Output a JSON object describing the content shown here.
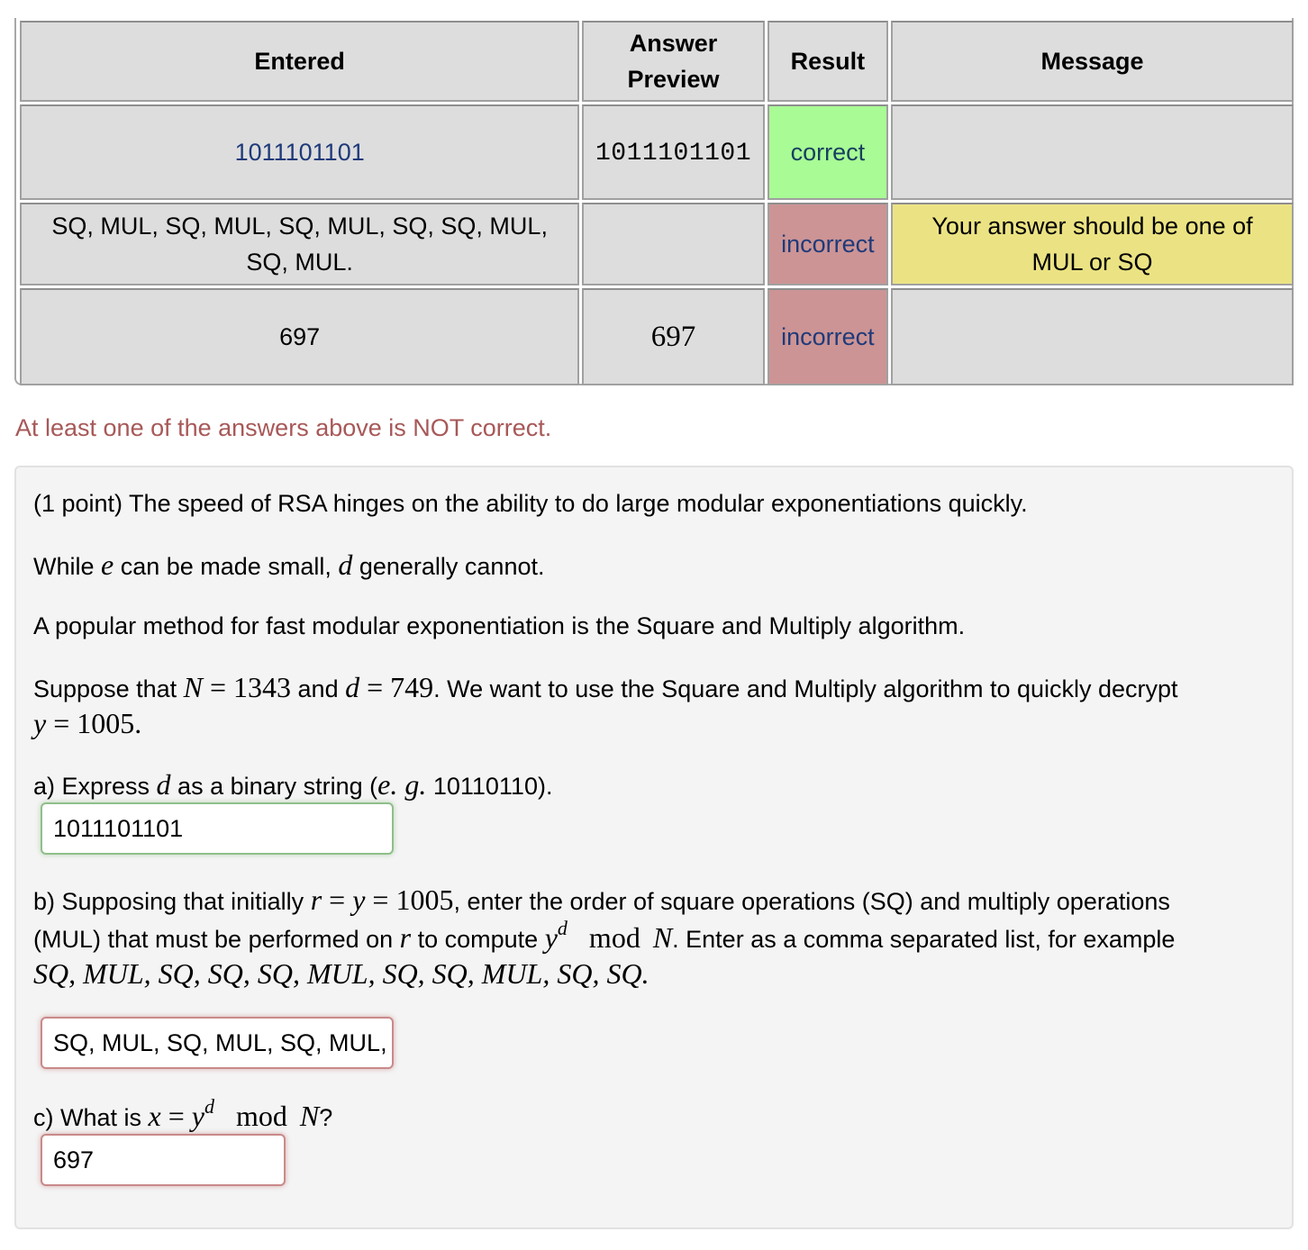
{
  "results_table": {
    "headers": {
      "entered": "Entered",
      "answer_preview_line1": "Answer",
      "answer_preview_line2": "Preview",
      "result": "Result",
      "message": "Message"
    },
    "rows": [
      {
        "entered": "1011101101",
        "preview": "1011101101",
        "result": "correct",
        "message": ""
      },
      {
        "entered_line1": "SQ, MUL, SQ, MUL, SQ, MUL, SQ, SQ, MUL,",
        "entered_line2": "SQ, MUL.",
        "preview": "",
        "result": "incorrect",
        "message_line1": "Your answer should be one of",
        "message_line2": "MUL or SQ"
      },
      {
        "entered": "697",
        "preview": "697",
        "result": "incorrect",
        "message": ""
      }
    ]
  },
  "status_message": "At least one of the answers above is NOT correct.",
  "problem": {
    "intro": "(1 point) The speed of RSA hinges on the ability to do large modular exponentiations quickly.",
    "line2": {
      "a": "While ",
      "e": "e",
      "b": " can be made small, ",
      "d": "d",
      "c": " generally cannot."
    },
    "line3": "A popular method for fast modular exponentiation is the Square and Multiply algorithm.",
    "line4": {
      "a": "Suppose that ",
      "N": "N",
      "eq1": " = ",
      "Nval": "1343",
      "and": " and ",
      "d": "d",
      "eq2": " = ",
      "dval": "749",
      "b": ". We want to use the Square and Multiply algorithm to quickly decrypt",
      "y": "y",
      "eq3": " = ",
      "yval": "1005",
      "end": "."
    },
    "part_a": {
      "a": "a) Express ",
      "d": "d",
      "b": " as a binary string (",
      "eg": "e. g.",
      "c": " 10110110).",
      "answer": "1011101101",
      "status": "correct"
    },
    "part_b": {
      "a": "b) Supposing that initially ",
      "r": "r",
      "eq": " = ",
      "y": "y",
      "eq2": " = ",
      "yval": "1005",
      "b": ", enter the order of square operations (SQ) and multiply operations",
      "c": "(MUL) that must be performed on ",
      "r2": "r",
      "d": " to compute ",
      "y2": "y",
      "sup": "d",
      "mod": "mod",
      "N": "N",
      "e": ". Enter as a comma separated list, for example",
      "example": "SQ, MUL, SQ, SQ, SQ, MUL, SQ, SQ, MUL, SQ, SQ.",
      "answer": "SQ, MUL, SQ, MUL, SQ, MUL, SQ, SQ, MUL, SQ, MUL.",
      "status": "incorrect"
    },
    "part_c": {
      "a": "c) What is ",
      "x": "x",
      "eq": " = ",
      "y": "y",
      "sup": "d",
      "mod": "mod",
      "N": "N",
      "q": "?",
      "answer": "697",
      "status": "incorrect"
    }
  },
  "colors": {
    "correct_bg": "#a8fb95",
    "incorrect_bg": "#cc9494",
    "warning_bg": "#ebe383",
    "status_text": "#a85858",
    "link_text": "#1f3a7a"
  }
}
